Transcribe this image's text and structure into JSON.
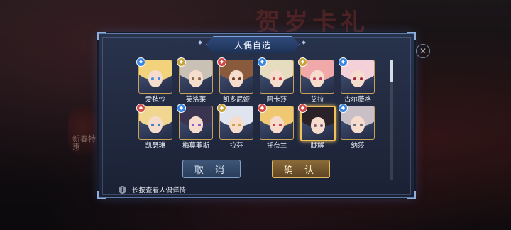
{
  "background": {
    "event_title": "贺岁卡礼",
    "side_badge": "新春特惠"
  },
  "dialog": {
    "title": "人偶自选",
    "characters": [
      {
        "name": "爱毡怜",
        "hair": "#f2d27a",
        "eye": "#4a8fe0",
        "badge_color": "#3a86e0"
      },
      {
        "name": "芙洛莱",
        "hair": "#c9c0b6",
        "eye": "#8a6a4e",
        "badge_color": "#c9a23a"
      },
      {
        "name": "凯多尼娅",
        "hair": "#8a5a3c",
        "eye": "#6e3e2a",
        "badge_color": "#d04a4a"
      },
      {
        "name": "阿卡莎",
        "hair": "#e6dcc0",
        "eye": "#d04040",
        "badge_color": "#3a86e0"
      },
      {
        "name": "艾拉",
        "hair": "#f0a8a8",
        "eye": "#c04060",
        "badge_color": "#c9a23a"
      },
      {
        "name": "古尔薇格",
        "hair": "#f4d0d8",
        "eye": "#a02840",
        "badge_color": "#3a86e0"
      },
      {
        "name": "凯瑟琳",
        "hair": "#f0d690",
        "eye": "#3e7ec8",
        "badge_color": "#d04a4a"
      },
      {
        "name": "梅莫菲斯",
        "hair": "#3a3450",
        "eye": "#8a5ad0",
        "badge_color": "#3a86e0"
      },
      {
        "name": "拉芬",
        "hair": "#dfe4ee",
        "eye": "#d0a040",
        "badge_color": "#c9a23a"
      },
      {
        "name": "托奈兰",
        "hair": "#f0c872",
        "eye": "#d04040",
        "badge_color": "#d04a4a"
      },
      {
        "name": "胧解",
        "hair": "#2a2228",
        "eye": "#8a5a7a",
        "badge_color": "#d04a4a",
        "selected": true
      },
      {
        "name": "纳莎",
        "hair": "#c8c0c6",
        "eye": "#6a6a8a",
        "badge_color": "#3a86e0"
      }
    ],
    "cancel_label": "取 消",
    "confirm_label": "确 认",
    "hint": "长按查看人偶详情",
    "hint_icon": "info-icon"
  },
  "close_icon": "close-icon",
  "colors": {
    "accent_gold": "#f1c25a",
    "frame_blue": "#5f7aa6"
  }
}
